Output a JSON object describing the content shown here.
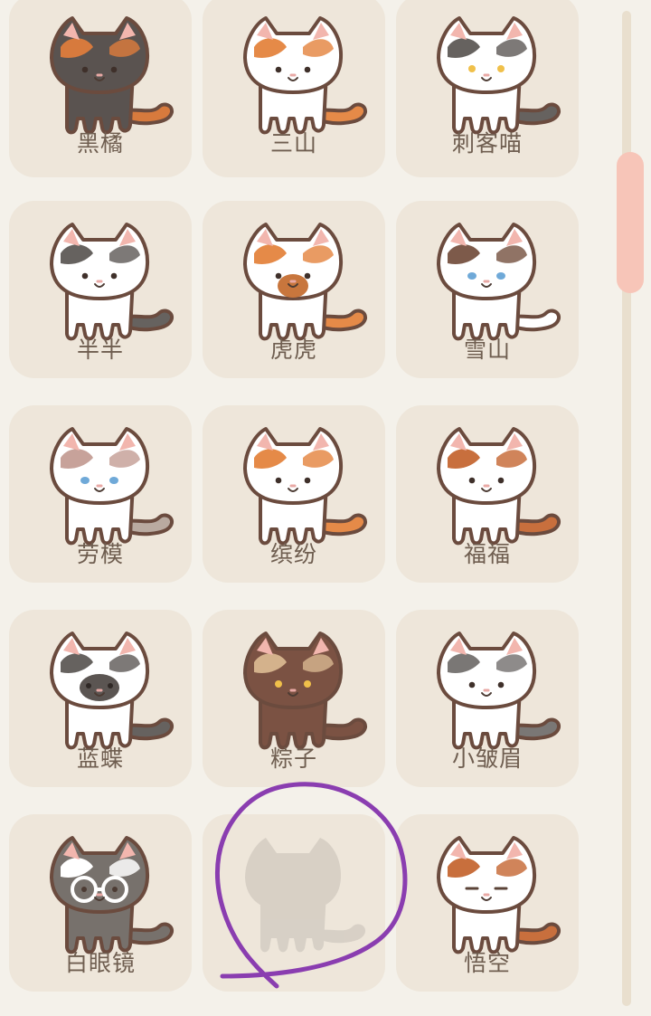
{
  "screen": {
    "title": "",
    "theme": {
      "background": "#f4f1ea",
      "card": "#eee6da",
      "label": "#6f5e50",
      "outline": "#6b4b3e",
      "scrollbar_track": "#e9dfce",
      "scrollbar_thumb": "#f7c5b8",
      "annotation": "#8a3db0"
    }
  },
  "cats": [
    {
      "name": "黑橘",
      "icon": "black-orange-cat-icon",
      "coat": "#5a5350",
      "patch": "#d77a3d",
      "tail": "#d77a3d",
      "collar": "none",
      "face": "dots",
      "unlocked": true
    },
    {
      "name": "三山",
      "icon": "orange-white-cat-icon",
      "coat": "#ffffff",
      "patch": "#e58a48",
      "tail": "#e58a48",
      "collar": "none",
      "face": "dots",
      "unlocked": true
    },
    {
      "name": "刺客喵",
      "icon": "assassin-cat-icon",
      "coat": "#ffffff",
      "patch": "#66625f",
      "tail": "#66625f",
      "collar": "none",
      "face": "yellow",
      "unlocked": true
    },
    {
      "name": "半半",
      "icon": "half-half-cat-icon",
      "coat": "#ffffff",
      "patch": "#66625f",
      "tail": "#66625f",
      "collar": "none",
      "face": "dots",
      "unlocked": true
    },
    {
      "name": "虎虎",
      "icon": "tiger-cat-icon",
      "coat": "#ffffff",
      "patch": "#e58a48",
      "tail": "#e58a48",
      "collar": "none",
      "face": "muzzle",
      "unlocked": true
    },
    {
      "name": "雪山",
      "icon": "snow-mountain-cat-icon",
      "coat": "#ffffff",
      "patch": "#7d5a4a",
      "tail": "#ffffff",
      "collar": "none",
      "face": "blue",
      "unlocked": true
    },
    {
      "name": "劳模",
      "icon": "model-worker-cat-icon",
      "coat": "#ffffff",
      "patch": "#c7a29a",
      "tail": "#b9aaa0",
      "collar": "none",
      "face": "blue",
      "unlocked": true
    },
    {
      "name": "缤纷",
      "icon": "colorful-cat-icon",
      "coat": "#ffffff",
      "patch": "#e58a48",
      "tail": "#e58a48",
      "collar": "none",
      "face": "dots",
      "unlocked": true
    },
    {
      "name": "福福",
      "icon": "lucky-cat-icon",
      "coat": "#ffffff",
      "patch": "#c86f3d",
      "tail": "#c86f3d",
      "collar": "none",
      "face": "dots",
      "unlocked": true
    },
    {
      "name": "蓝蝶",
      "icon": "blue-butterfly-cat-icon",
      "coat": "#ffffff",
      "patch": "#66625f",
      "tail": "#66625f",
      "collar": "none",
      "face": "dark",
      "unlocked": true
    },
    {
      "name": "粽子",
      "icon": "zongzi-cat-icon",
      "coat": "#7b5243",
      "patch": "#d4b28c",
      "tail": "#7b5243",
      "collar": "none",
      "face": "yellow",
      "unlocked": true
    },
    {
      "name": "小皱眉",
      "icon": "little-frown-cat-icon",
      "coat": "#ffffff",
      "patch": "#7a7775",
      "tail": "#7a7775",
      "collar": "none",
      "face": "dots",
      "unlocked": true
    },
    {
      "name": "白眼镜",
      "icon": "white-glasses-cat-icon",
      "coat": "#77716c",
      "patch": "#ffffff",
      "tail": "#77716c",
      "collar": "glasses",
      "face": "glasses",
      "unlocked": true
    },
    {
      "name": "",
      "icon": "locked-cat-silhouette-icon",
      "coat": "#d6cfc5",
      "patch": "#d6cfc5",
      "tail": "#d6cfc5",
      "collar": "none",
      "face": "none",
      "unlocked": false
    },
    {
      "name": "悟空",
      "icon": "wukong-cat-icon",
      "coat": "#ffffff",
      "patch": "#c86f3d",
      "tail": "#c86f3d",
      "collar": "none",
      "face": "sleepy",
      "unlocked": true
    }
  ]
}
